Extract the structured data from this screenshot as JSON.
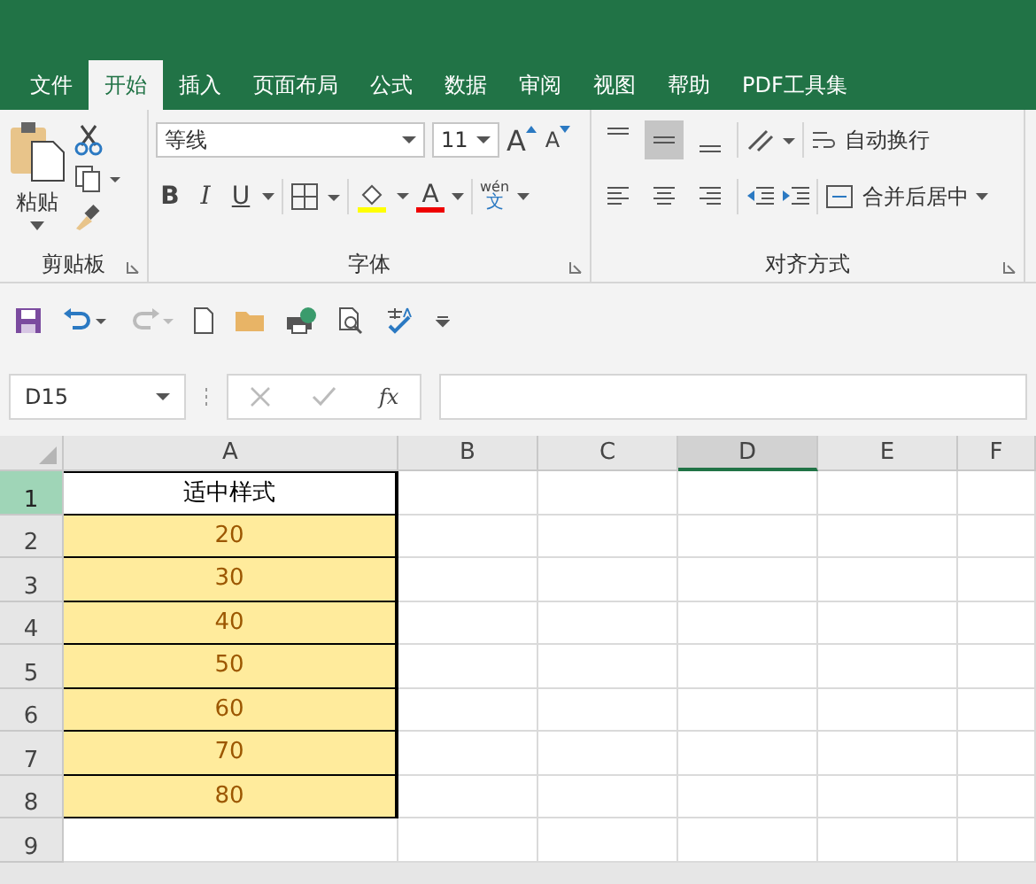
{
  "tabs": [
    {
      "label": "文件",
      "selected": false
    },
    {
      "label": "开始",
      "selected": true
    },
    {
      "label": "插入",
      "selected": false
    },
    {
      "label": "页面布局",
      "selected": false
    },
    {
      "label": "公式",
      "selected": false
    },
    {
      "label": "数据",
      "selected": false
    },
    {
      "label": "审阅",
      "selected": false
    },
    {
      "label": "视图",
      "selected": false
    },
    {
      "label": "帮助",
      "selected": false
    },
    {
      "label": "PDF工具集",
      "selected": false
    }
  ],
  "ribbon": {
    "clipboard": {
      "label": "剪贴板",
      "paste": "粘贴"
    },
    "font": {
      "label": "字体",
      "font_name": "等线",
      "font_size": "11",
      "grow_font": "A",
      "shrink_font": "A",
      "bold": "B",
      "italic": "I",
      "underline": "U",
      "font_color": "A",
      "phonetic_top": "wén",
      "phonetic_bottom": "文"
    },
    "alignment": {
      "label": "对齐方式",
      "wrap_text": "自动换行",
      "merge_center": "合并后居中",
      "vertical_align": [
        {
          "kind": "top",
          "selected": false
        },
        {
          "kind": "middle",
          "selected": true
        },
        {
          "kind": "bottom",
          "selected": false
        }
      ],
      "horizontal_align": [
        {
          "kind": "left",
          "selected": false
        },
        {
          "kind": "center",
          "selected": false
        },
        {
          "kind": "right",
          "selected": false
        }
      ]
    }
  },
  "quick_access": {
    "redo": {
      "disabled": true
    }
  },
  "formula_bar": {
    "name_box": "D15",
    "function_label": "fx"
  },
  "sheet": {
    "columns": [
      {
        "label": "A",
        "selected": false
      },
      {
        "label": "B",
        "selected": false
      },
      {
        "label": "C",
        "selected": false
      },
      {
        "label": "D",
        "selected": true
      },
      {
        "label": "E",
        "selected": false
      },
      {
        "label": "F",
        "selected": false
      }
    ],
    "rows": [
      {
        "label": "1",
        "selected": true,
        "cells": [
          {
            "value": "适中样式",
            "kind": "plain"
          }
        ]
      },
      {
        "label": "2",
        "selected": false,
        "cells": [
          {
            "value": "20",
            "kind": "neutral"
          }
        ]
      },
      {
        "label": "3",
        "selected": false,
        "cells": [
          {
            "value": "30",
            "kind": "neutral"
          }
        ]
      },
      {
        "label": "4",
        "selected": false,
        "cells": [
          {
            "value": "40",
            "kind": "neutral"
          }
        ]
      },
      {
        "label": "5",
        "selected": false,
        "cells": [
          {
            "value": "50",
            "kind": "neutral"
          }
        ]
      },
      {
        "label": "6",
        "selected": false,
        "cells": [
          {
            "value": "60",
            "kind": "neutral"
          }
        ]
      },
      {
        "label": "7",
        "selected": false,
        "cells": [
          {
            "value": "70",
            "kind": "neutral"
          }
        ]
      },
      {
        "label": "8",
        "selected": false,
        "cells": [
          {
            "value": "80",
            "kind": "neutral"
          }
        ]
      },
      {
        "label": "9",
        "selected": false
      }
    ]
  }
}
